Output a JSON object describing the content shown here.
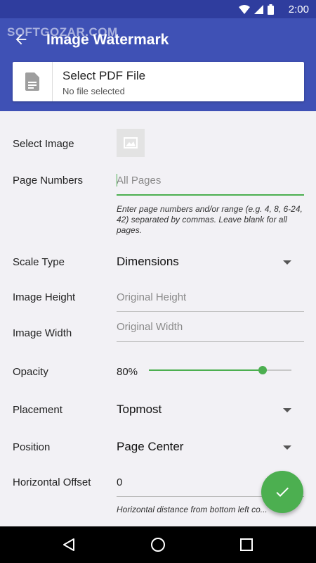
{
  "status_bar": {
    "time": "2:00"
  },
  "watermark": "SOFTGOZAR.COM",
  "app_bar": {
    "title": "Image Watermark"
  },
  "pdf_select": {
    "title": "Select PDF File",
    "subtitle": "No file selected"
  },
  "form": {
    "select_image_label": "Select Image",
    "page_numbers": {
      "label": "Page Numbers",
      "placeholder": "All Pages",
      "value": "",
      "helper": "Enter page numbers and/or range (e.g. 4, 8, 6-24, 42) separated by commas. Leave blank for all pages."
    },
    "scale_type": {
      "label": "Scale Type",
      "value": "Dimensions"
    },
    "image_height": {
      "label": "Image Height",
      "placeholder": "Original Height"
    },
    "image_width": {
      "label": "Image Width",
      "placeholder": "Original Width"
    },
    "opacity": {
      "label": "Opacity",
      "value_text": "80%",
      "value": 0.8
    },
    "placement": {
      "label": "Placement",
      "value": "Topmost"
    },
    "position": {
      "label": "Position",
      "value": "Page Center"
    },
    "horizontal_offset": {
      "label": "Horizontal Offset",
      "value": "0",
      "helper": "Horizontal distance from bottom left co..."
    }
  },
  "colors": {
    "primary": "#3f51b5",
    "primary_dark": "#2f3d9e",
    "accent": "#4caf50",
    "background": "#f2f1f5"
  },
  "icons": {
    "back": "arrow-back-icon",
    "file": "document-icon",
    "image": "image-icon",
    "fab": "check-icon",
    "nav_back": "nav-back-icon",
    "nav_home": "nav-home-icon",
    "nav_recents": "nav-recents-icon"
  }
}
